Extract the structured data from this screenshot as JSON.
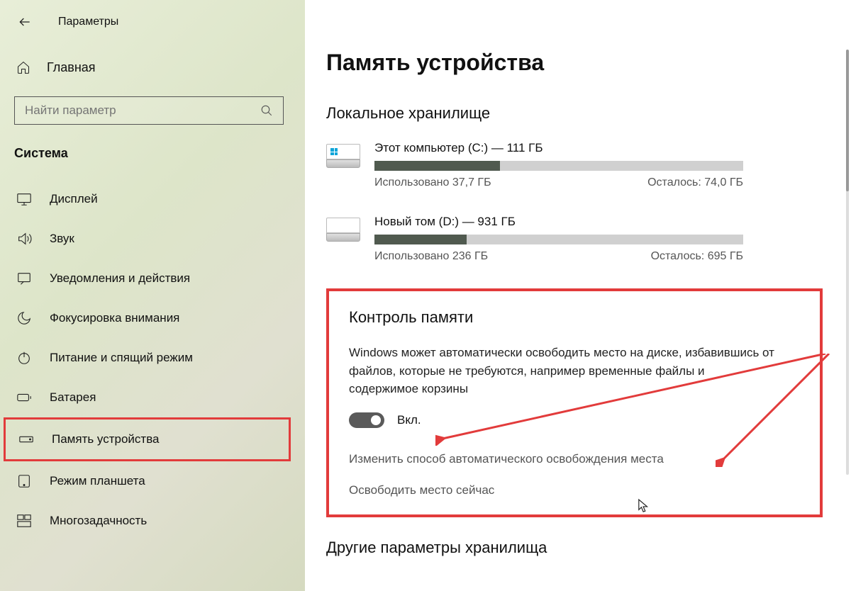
{
  "header": {
    "title": "Параметры"
  },
  "home": {
    "label": "Главная"
  },
  "search": {
    "placeholder": "Найти параметр"
  },
  "section": {
    "title": "Система"
  },
  "nav": {
    "display": "Дисплей",
    "sound": "Звук",
    "notifications": "Уведомления и действия",
    "focus": "Фокусировка внимания",
    "power": "Питание и спящий режим",
    "battery": "Батарея",
    "storage": "Память устройства",
    "tablet": "Режим планшета",
    "multitask": "Многозадачность"
  },
  "page": {
    "title": "Память устройства",
    "local_title": "Локальное хранилище",
    "storage_sense_title": "Контроль памяти",
    "ss_desc": "Windows может автоматически освободить место на диске, избавившись от файлов, которые не требуются, например временные файлы и содержимое корзины",
    "toggle_label": "Вкл.",
    "link1": "Изменить способ автоматического освобождения места",
    "link2": "Освободить место сейчас",
    "other_title": "Другие параметры хранилища"
  },
  "drives": [
    {
      "label": "Этот компьютер (C:) — 111 ГБ",
      "used": "Использовано 37,7 ГБ",
      "remaining": "Осталось: 74,0 ГБ",
      "percent": 34
    },
    {
      "label": "Новый том (D:) — 931 ГБ",
      "used": "Использовано 236 ГБ",
      "remaining": "Осталось: 695 ГБ",
      "percent": 25
    }
  ]
}
